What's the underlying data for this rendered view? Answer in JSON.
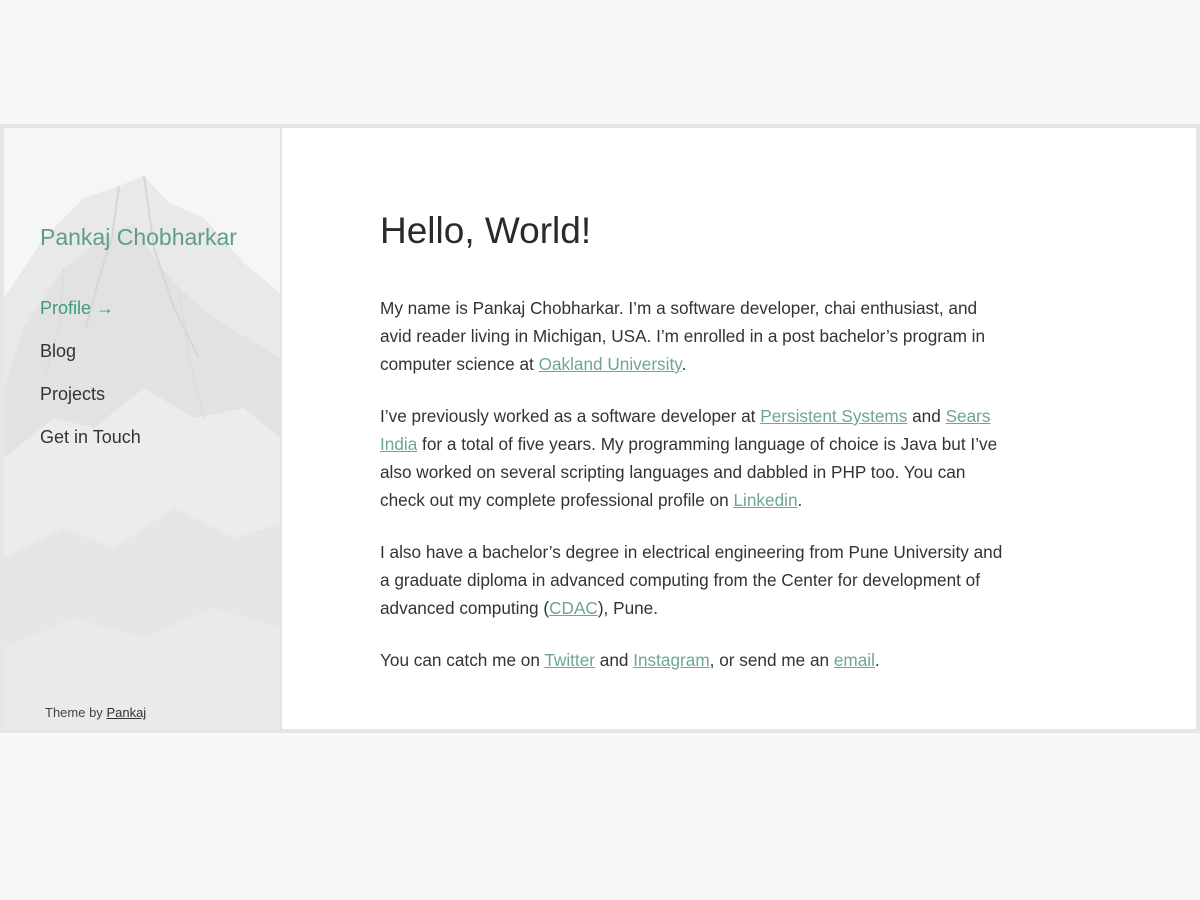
{
  "sidebar": {
    "site_title": "Pankaj Chobharkar",
    "nav": [
      {
        "label": "Profile",
        "icon": "→",
        "active": true
      },
      {
        "label": "Blog"
      },
      {
        "label": "Projects"
      },
      {
        "label": "Get in Touch"
      }
    ],
    "credit_prefix": "Theme by",
    "credit_link": "Pankaj"
  },
  "main": {
    "heading": "Hello, World!",
    "p1": {
      "text1": "My name is Pankaj Chobharkar. I’m a software developer, chai enthusiast, and avid reader living in Michigan, USA. I’m enrolled in a post bachelor’s program in computer science at ",
      "link1": "Oakland University",
      "text2": "."
    },
    "p2": {
      "text1": "I’ve previously worked as a software developer at ",
      "link1": "Persistent Systems",
      "text2": " and ",
      "link2": "Sears India",
      "text3": " for a total of five years. My programming language of choice is Java but I’ve also worked on several scripting languages and dabbled in PHP too. You can check out my complete professional profile on ",
      "link3": "Linkedin",
      "text4": "."
    },
    "p3": {
      "text1": "I also have a bachelor’s degree in electrical engineering from Pune University and a graduate diploma in advanced computing from the Center for development of advanced computing (",
      "link1": "CDAC",
      "text2": "), Pune."
    },
    "p4": {
      "text1": "You can catch me on ",
      "link1": "Twitter",
      "text2": " and ",
      "link2": "Instagram",
      "text3": ", or send me an ",
      "link3": "email",
      "text4": "."
    }
  },
  "colors": {
    "accent": "#3f9a7b",
    "link": "#6ea693",
    "title": "#5e9e88",
    "page_bg": "#f8f8f8",
    "frame_border": "#e6e6e6"
  }
}
